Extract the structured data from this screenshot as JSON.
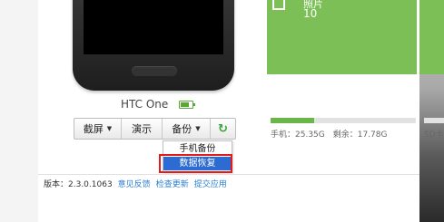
{
  "device": {
    "name": "HTC One"
  },
  "toolbar": {
    "screenshot_label": "截屏",
    "demo_label": "演示",
    "backup_label": "备份",
    "refresh_icon": "refresh-icon"
  },
  "backup_menu": {
    "items": [
      "手机备份",
      "数据恢复"
    ],
    "selected": "数据恢复"
  },
  "tile": {
    "label": "照片",
    "count": "10",
    "icon": "image-icon",
    "color": "#7bbf56"
  },
  "storage": {
    "phone_text": "手机：25.35G　剩余：17.78G",
    "sd_text": "SD卡",
    "used_fraction": 0.3,
    "color": "#6ab64a"
  },
  "footer": {
    "version": "版本：2.3.0.1063",
    "links": [
      "意见反馈",
      "检查更新",
      "提交应用"
    ]
  },
  "colors": {
    "accent_blue": "#2b6bd2",
    "highlight_red": "#e31b1b",
    "link_blue": "#2a7fd4"
  }
}
